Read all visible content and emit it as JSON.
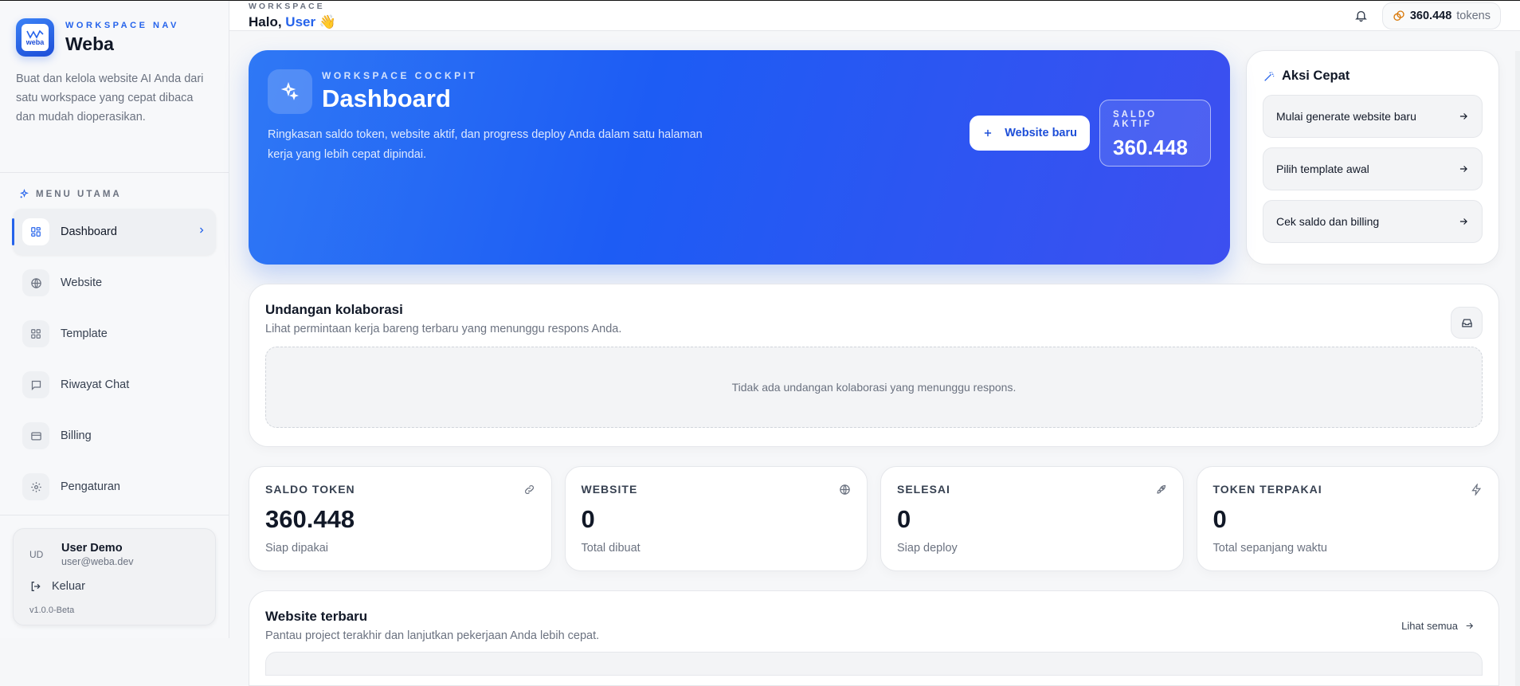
{
  "sidebar": {
    "eyebrow": "WORKSPACE NAV",
    "brand": "Weba",
    "logo_text": "weba",
    "description": "Buat dan kelola website AI Anda dari satu workspace yang cepat dibaca dan mudah dioperasikan.",
    "menu_title": "MENU UTAMA",
    "items": [
      {
        "label": "Dashboard",
        "icon": "grid-icon"
      },
      {
        "label": "Website",
        "icon": "globe-icon"
      },
      {
        "label": "Template",
        "icon": "template-icon"
      },
      {
        "label": "Riwayat Chat",
        "icon": "chat-icon"
      },
      {
        "label": "Billing",
        "icon": "card-icon"
      },
      {
        "label": "Pengaturan",
        "icon": "gear-icon"
      }
    ],
    "user": {
      "initials": "UD",
      "name": "User Demo",
      "email": "user@weba.dev",
      "logout": "Keluar",
      "version": "v1.0.0-Beta"
    }
  },
  "topbar": {
    "eyebrow": "WORKSPACE",
    "greeting": "Halo,",
    "user": "User",
    "wave": "👋",
    "token_value": "360.448",
    "token_unit": "tokens"
  },
  "hero": {
    "eyebrow": "WORKSPACE COCKPIT",
    "title": "Dashboard",
    "description": "Ringkasan saldo token, website aktif, dan progress deploy Anda dalam satu halaman kerja yang lebih cepat dipindai.",
    "new_button": "Website baru",
    "saldo_label": "SALDO AKTIF",
    "saldo_value": "360.448"
  },
  "quick_actions": {
    "title": "Aksi Cepat",
    "items": [
      {
        "label": "Mulai generate website baru"
      },
      {
        "label": "Pilih template awal"
      },
      {
        "label": "Cek saldo dan billing"
      }
    ]
  },
  "invitations": {
    "title": "Undangan kolaborasi",
    "subtitle": "Lihat permintaan kerja bareng terbaru yang menunggu respons Anda.",
    "empty": "Tidak ada undangan kolaborasi yang menunggu respons."
  },
  "stats": [
    {
      "label": "SALDO TOKEN",
      "value": "360.448",
      "sub": "Siap dipakai",
      "icon": "link-icon"
    },
    {
      "label": "WEBSITE",
      "value": "0",
      "sub": "Total dibuat",
      "icon": "globe-icon"
    },
    {
      "label": "SELESAI",
      "value": "0",
      "sub": "Siap deploy",
      "icon": "rocket-icon"
    },
    {
      "label": "TOKEN TERPAKAI",
      "value": "0",
      "sub": "Total sepanjang waktu",
      "icon": "bolt-icon"
    }
  ],
  "recent": {
    "title": "Website terbaru",
    "subtitle": "Pantau project terakhir dan lanjutkan pekerjaan Anda lebih cepat.",
    "see_all": "Lihat semua"
  },
  "colors": {
    "accent": "#2563eb",
    "hero_start": "#2f78f5",
    "hero_end": "#3d4ff0"
  }
}
